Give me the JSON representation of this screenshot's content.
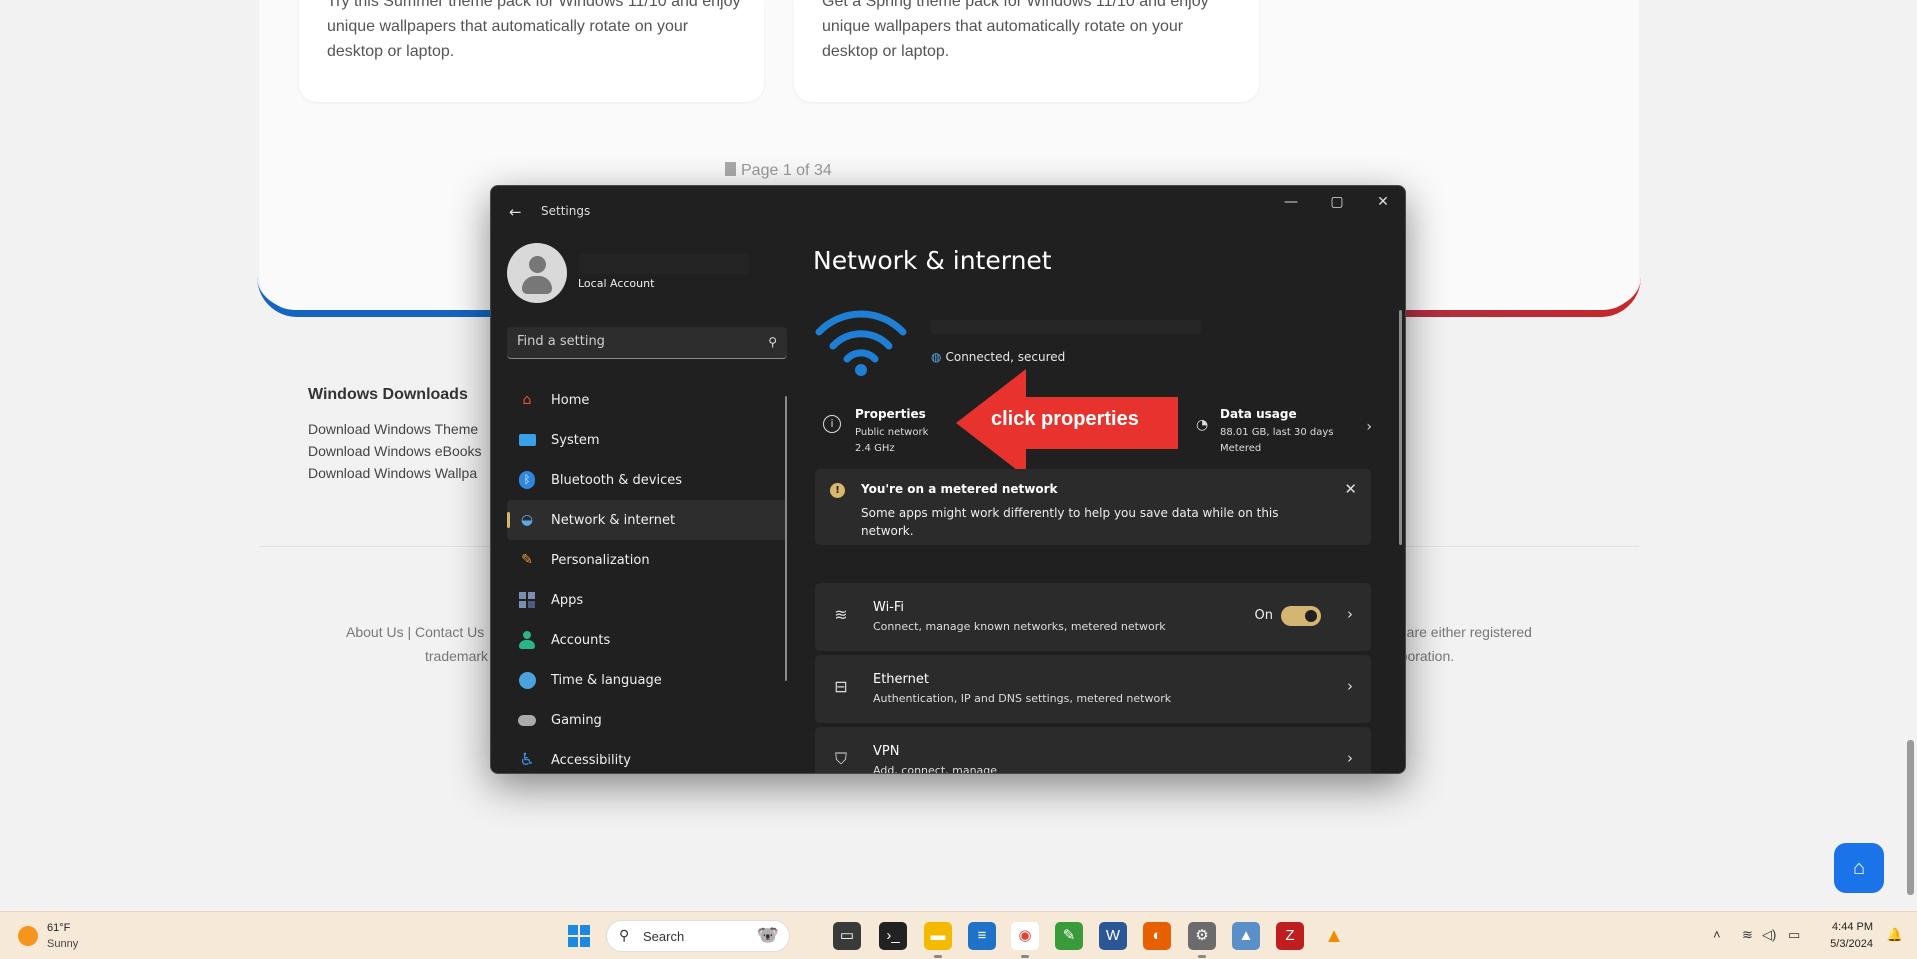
{
  "web": {
    "card1_text": "Try this Summer theme pack for Windows 11/10 and enjoy unique wallpapers that automatically rotate on your desktop or laptop.",
    "card2_text": "Get a Spring theme pack for Windows 11/10 and enjoy unique wallpapers that automatically rotate on your desktop or laptop.",
    "pager": "Page 1 of 34",
    "footer_heading": "Windows Downloads",
    "footer_links": [
      "Download Windows Theme",
      "Download Windows eBooks",
      "Download Windows Wallpa"
    ],
    "legal_left_1": "About Us | Contact Us",
    "legal_left_2": "trademark",
    "legal_right_1": "o are either registered",
    "legal_right_2": "rporation."
  },
  "settings": {
    "app_title": "Settings",
    "account_type": "Local Account",
    "search_placeholder": "Find a setting",
    "nav": [
      {
        "label": "Home",
        "icon": "home-icon",
        "color": "#e8533f"
      },
      {
        "label": "System",
        "icon": "monitor-icon",
        "color": "#3aa0e8"
      },
      {
        "label": "Bluetooth & devices",
        "icon": "bluetooth-icon",
        "color": "#2f86dd"
      },
      {
        "label": "Network & internet",
        "icon": "wifi-icon",
        "color": "#5aa9e6"
      },
      {
        "label": "Personalization",
        "icon": "brush-icon",
        "color": "#e89a3a"
      },
      {
        "label": "Apps",
        "icon": "apps-icon",
        "color": "#7a8fb0"
      },
      {
        "label": "Accounts",
        "icon": "person-icon",
        "color": "#2bb38a"
      },
      {
        "label": "Time & language",
        "icon": "globe-clock-icon",
        "color": "#4aa3df"
      },
      {
        "label": "Gaming",
        "icon": "gamepad-icon",
        "color": "#aaaaaa"
      },
      {
        "label": "Accessibility",
        "icon": "accessibility-icon",
        "color": "#3b8fe0"
      }
    ],
    "active_nav": "Network & internet",
    "page_title": "Network & internet",
    "connection_status": "Connected, secured",
    "properties": {
      "title": "Properties",
      "line1": "Public network",
      "line2": "2.4 GHz"
    },
    "data_usage": {
      "title": "Data usage",
      "line1": "88.01 GB, last 30 days",
      "line2": "Metered"
    },
    "annotation": "click properties",
    "metered": {
      "title": "You're on a metered network",
      "body": "Some apps might work differently to help you save data while on this network."
    },
    "rows": [
      {
        "title": "Wi-Fi",
        "sub": "Connect, manage known networks, metered network",
        "toggle_label": "On"
      },
      {
        "title": "Ethernet",
        "sub": "Authentication, IP and DNS settings, metered network"
      },
      {
        "title": "VPN",
        "sub": "Add, connect, manage"
      }
    ],
    "accent": "#d4b572"
  },
  "taskbar": {
    "temp": "61°F",
    "condition": "Sunny",
    "search_label": "Search",
    "time": "4:44 PM",
    "date": "5/3/2024"
  }
}
